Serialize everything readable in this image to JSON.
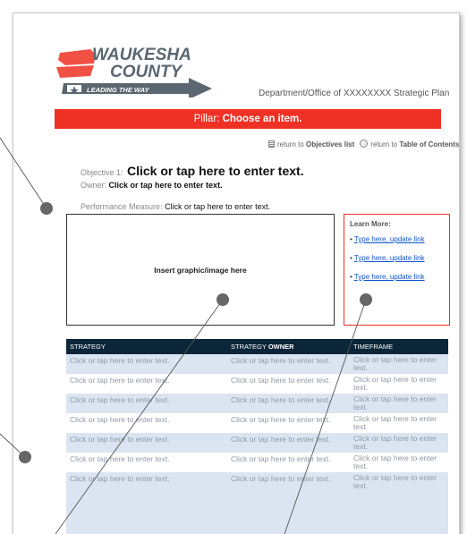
{
  "header": {
    "logo_line1": "WAUKESHA",
    "logo_line2": "COUNTY",
    "logo_tagline": "LEADING THE WAY",
    "department": "Department/Office of XXXXXXXX Strategic Plan"
  },
  "pillar": {
    "label": "Pillar:",
    "value": "Choose an item."
  },
  "returns": {
    "prefix1": "return to",
    "link1": "Objectives list",
    "prefix2": "return to",
    "link2": "Table of Contents"
  },
  "objective": {
    "label": "Objective 1:",
    "value": "Click or tap here to enter text.",
    "owner_label": "Owner:",
    "owner_value": "Click or tap here to enter text.",
    "measure_label": "Performance Measure:",
    "measure_value": "Click or tap here to enter text."
  },
  "graphic": {
    "placeholder": "Insert graphic/image here"
  },
  "learn_more": {
    "title": "Learn More:",
    "links": [
      "Type here, update link",
      "Type here, update link",
      "Type here, update link"
    ]
  },
  "table": {
    "headers": {
      "strategy": "STRATEGY",
      "owner_prefix": "STRATEGY ",
      "owner_bold": "OWNER",
      "timeframe": "TIMEFRAME"
    },
    "rows": [
      [
        "Click or tap here to enter text.",
        "Click or tap here to enter text.",
        "Click or tap here to enter text."
      ],
      [
        "Click or tap here to enter text.",
        "Click or tap here to enter text.",
        "Click or tap here to enter text."
      ],
      [
        "Click or tap here to enter text.",
        "Click or tap here to enter text.",
        "Click or tap here to enter text."
      ],
      [
        "Click or tap here to enter text.",
        "Click or tap here to enter text.",
        "Click or tap here to enter text."
      ],
      [
        "Click or tap here to enter text.",
        "Click or tap here to enter text.",
        "Click or tap here to enter text."
      ],
      [
        "Click or tap here to enter text.",
        "Click or tap here to enter text.",
        "Click or tap here to enter text."
      ],
      [
        "Click or tap here to enter text.",
        "Click or tap here to enter text.",
        "Click or tap here to enter text."
      ]
    ]
  },
  "colors": {
    "pillar_bar": "#ee3124",
    "table_header": "#0b2639",
    "row_shade": "#dbe5f1",
    "link": "#1155cc",
    "callout": "#555555"
  }
}
